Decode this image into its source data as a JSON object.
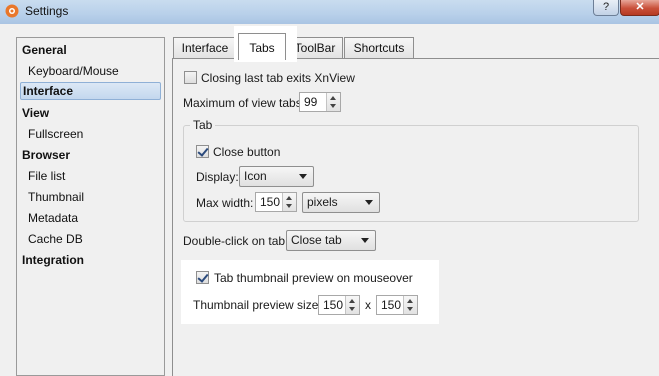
{
  "window": {
    "title": "Settings",
    "help_label": "?",
    "close_label": "✕"
  },
  "sidebar": {
    "items": [
      {
        "label": "General",
        "kind": "header"
      },
      {
        "label": "Keyboard/Mouse",
        "kind": "child"
      },
      {
        "label": "Interface",
        "kind": "header",
        "selected": true
      },
      {
        "label": "View",
        "kind": "header"
      },
      {
        "label": "Fullscreen",
        "kind": "child"
      },
      {
        "label": "Browser",
        "kind": "header"
      },
      {
        "label": "File list",
        "kind": "child"
      },
      {
        "label": "Thumbnail",
        "kind": "child"
      },
      {
        "label": "Metadata",
        "kind": "child"
      },
      {
        "label": "Cache DB",
        "kind": "child"
      },
      {
        "label": "Integration",
        "kind": "header"
      }
    ]
  },
  "tabs": [
    {
      "label": "Interface"
    },
    {
      "label": "Tabs",
      "active": true
    },
    {
      "label": "ToolBar"
    },
    {
      "label": "Shortcuts"
    }
  ],
  "tabs_page": {
    "closing_last_tab": {
      "label": "Closing last tab exits XnView",
      "checked": false
    },
    "max_view_tabs": {
      "label": "Maximum of view tabs:",
      "value": "99"
    },
    "tab_group": {
      "title": "Tab",
      "close_button": {
        "label": "Close button",
        "checked": true
      },
      "display": {
        "label": "Display:",
        "value": "Icon"
      },
      "max_width": {
        "label": "Max width:",
        "value": "150",
        "unit": "pixels"
      }
    },
    "double_click": {
      "label": "Double-click on tab:",
      "value": "Close tab"
    },
    "thumb_preview": {
      "label": "Tab thumbnail preview on mouseover",
      "checked": true
    },
    "thumb_size": {
      "label": "Thumbnail preview size:",
      "width": "150",
      "separator": "x",
      "height": "150"
    }
  },
  "colors": {
    "selection": "#c3d7ee",
    "close_button": "#c9503a",
    "titlebar": "#b8d0ea"
  }
}
